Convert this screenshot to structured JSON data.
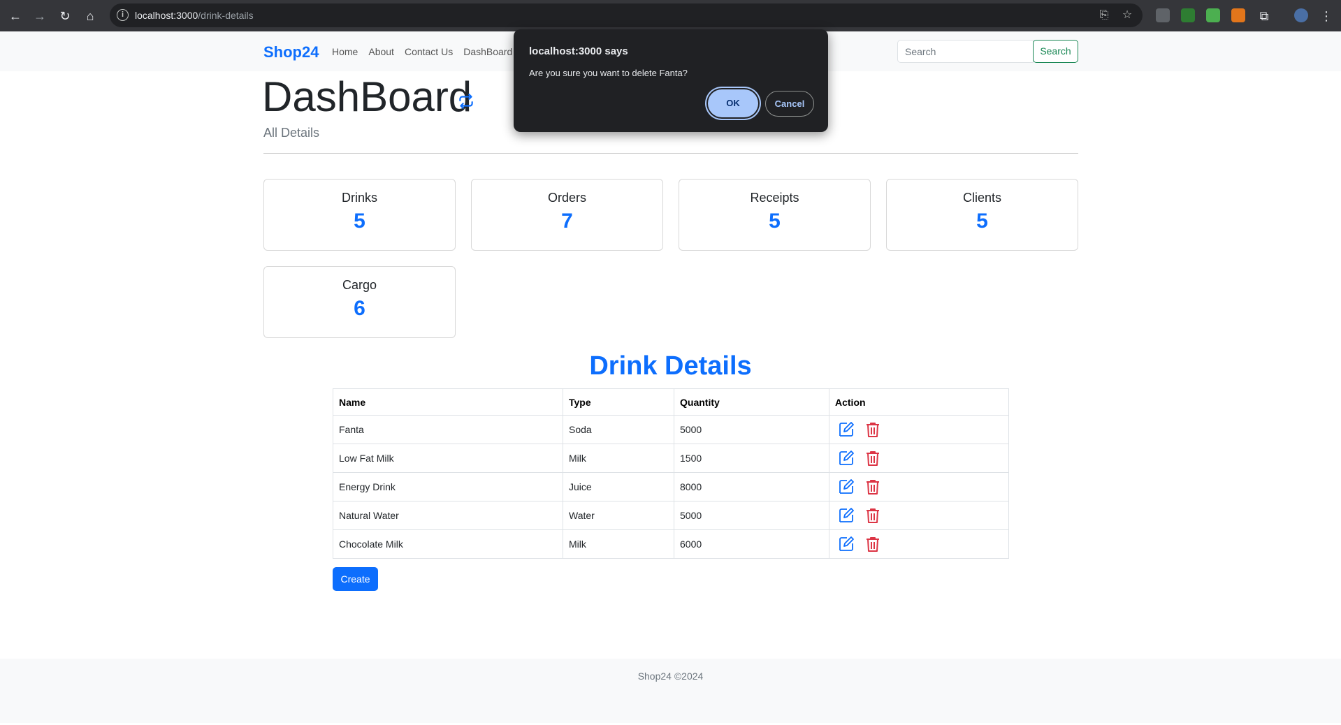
{
  "browser": {
    "url_host": "localhost:3000",
    "url_path": "/drink-details"
  },
  "navbar": {
    "brand": "Shop24",
    "links": [
      "Home",
      "About",
      "Contact Us",
      "DashBoard"
    ],
    "search_placeholder": "Search",
    "search_button": "Search"
  },
  "header": {
    "title": "DashBoard",
    "subtitle": "All Details"
  },
  "stats": [
    {
      "label": "Drinks",
      "value": "5"
    },
    {
      "label": "Orders",
      "value": "7"
    },
    {
      "label": "Receipts",
      "value": "5"
    },
    {
      "label": "Clients",
      "value": "5"
    },
    {
      "label": "Cargo",
      "value": "6"
    }
  ],
  "drinks": {
    "title": "Drink Details",
    "columns": [
      "Name",
      "Type",
      "Quantity",
      "Action"
    ],
    "rows": [
      {
        "name": "Fanta",
        "type": "Soda",
        "quantity": "5000"
      },
      {
        "name": "Low Fat Milk",
        "type": "Milk",
        "quantity": "1500"
      },
      {
        "name": "Energy Drink",
        "type": "Juice",
        "quantity": "8000"
      },
      {
        "name": "Natural Water",
        "type": "Water",
        "quantity": "5000"
      },
      {
        "name": "Chocolate Milk",
        "type": "Milk",
        "quantity": "6000"
      }
    ],
    "create_button": "Create"
  },
  "footer": {
    "text": "Shop24 ©2024"
  },
  "dialog": {
    "title": "localhost:3000 says",
    "message": "Are you sure you want to delete Fanta?",
    "ok": "OK",
    "cancel": "Cancel"
  },
  "colors": {
    "primary": "#0d6efd",
    "success": "#198754",
    "danger": "#dc3545",
    "dialog_bg": "#202124",
    "ok_bg": "#a8c7fa"
  },
  "icons": [
    "back-icon",
    "forward-icon",
    "reload-icon",
    "home-icon",
    "info-icon",
    "install-icon",
    "star-icon",
    "refresh-icon",
    "edit-icon",
    "trash-icon",
    "extensions-icon",
    "profile-icon",
    "menu-icon"
  ]
}
